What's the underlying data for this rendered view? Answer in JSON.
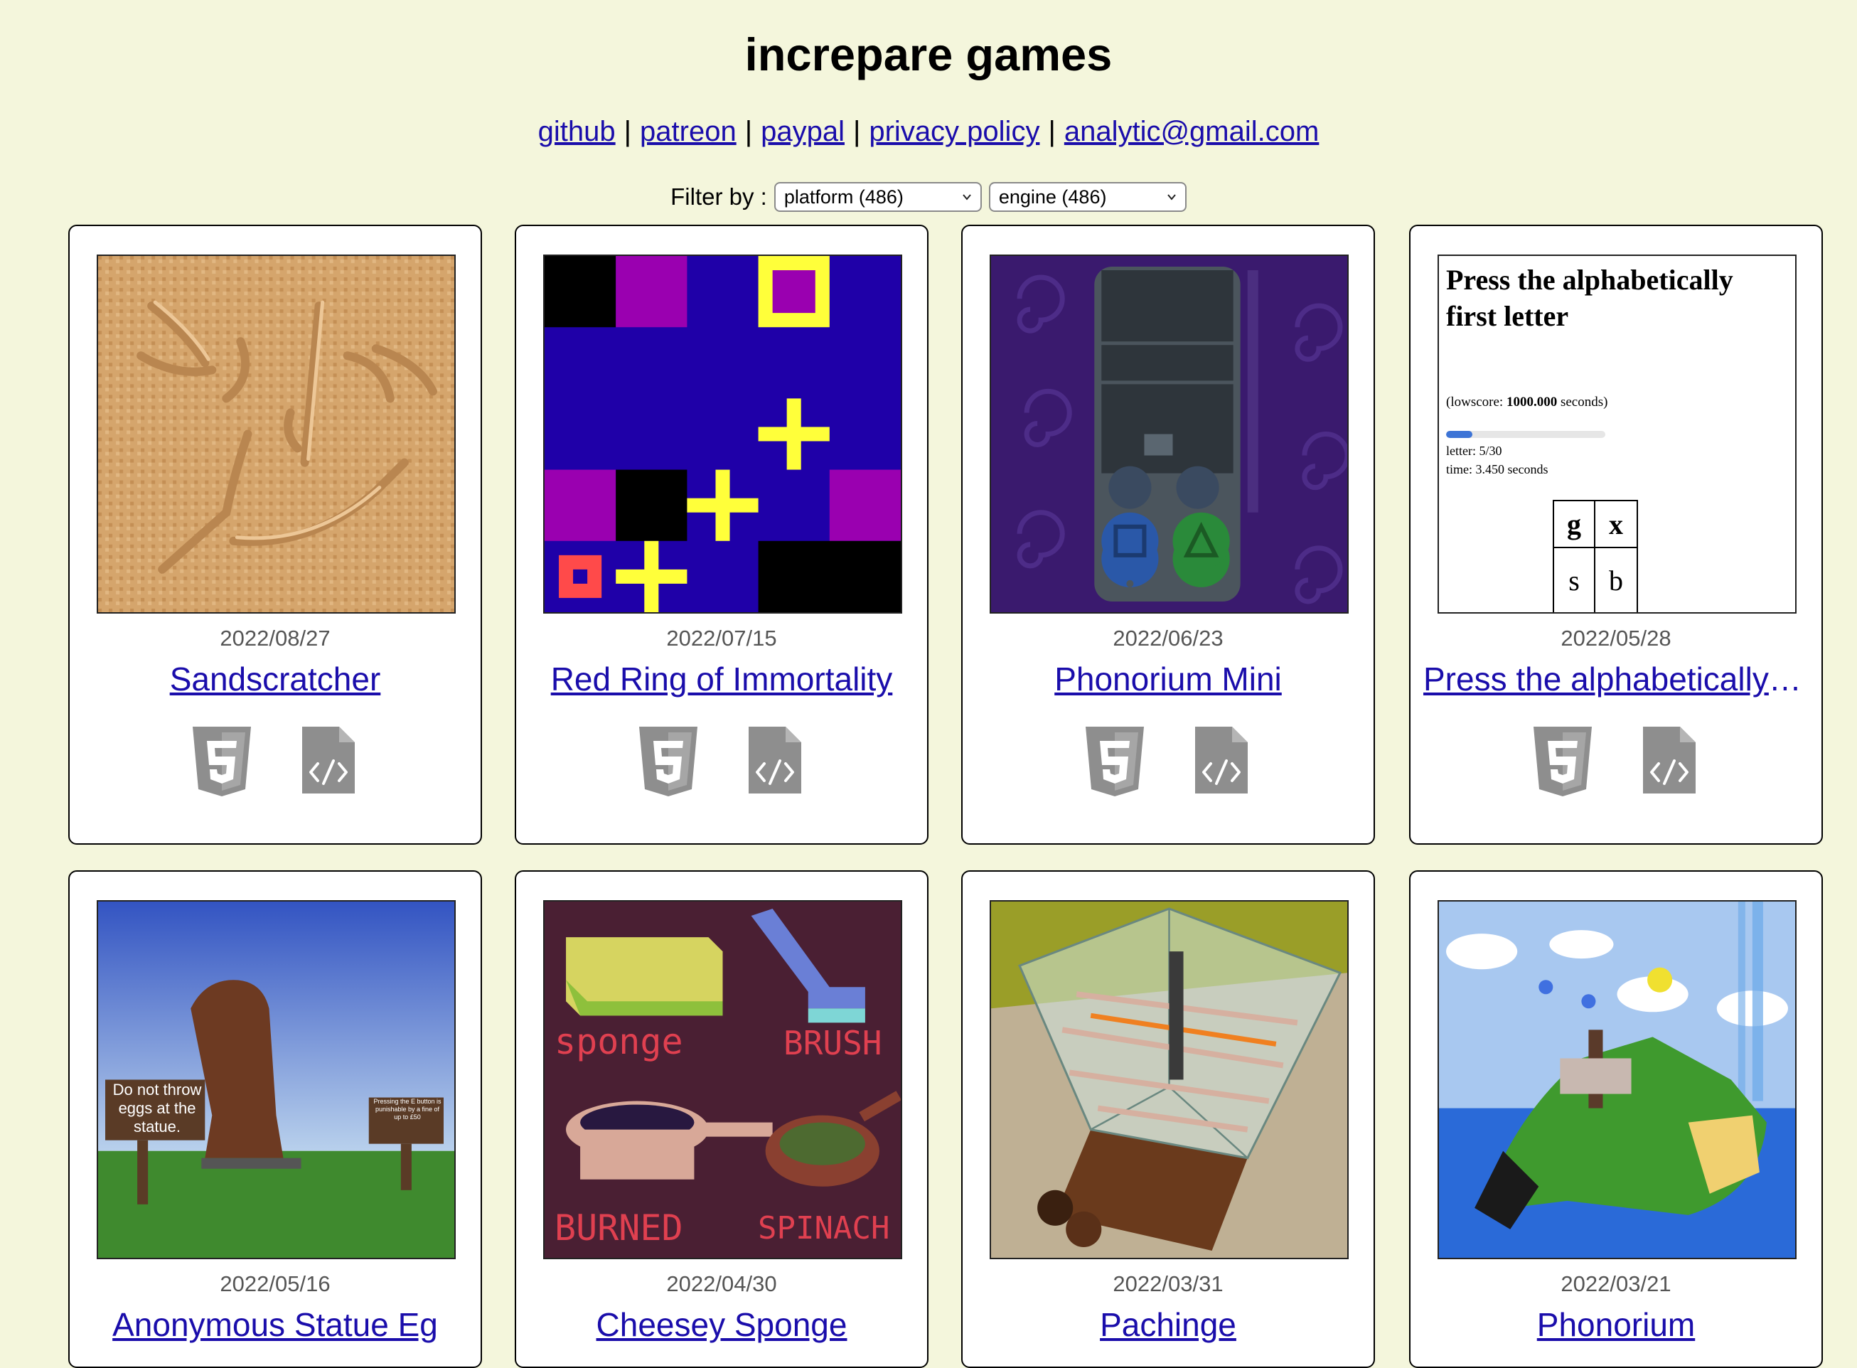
{
  "site": {
    "title": "increpare games",
    "links": [
      {
        "label": "github"
      },
      {
        "label": "patreon"
      },
      {
        "label": "paypal"
      },
      {
        "label": "privacy policy"
      },
      {
        "label": "analytic@gmail.com"
      }
    ],
    "separator": "|"
  },
  "filter": {
    "label": "Filter by :",
    "platform_value": "platform (486)",
    "engine_value": "engine (486)"
  },
  "games": [
    {
      "date": "2022/08/27",
      "title": "Sandscratcher",
      "platform_icon": "html5-icon",
      "source_icon": "source-code-icon"
    },
    {
      "date": "2022/07/15",
      "title": "Red Ring of Immortality",
      "platform_icon": "html5-icon",
      "source_icon": "source-code-icon"
    },
    {
      "date": "2022/06/23",
      "title": "Phonorium Mini",
      "platform_icon": "html5-icon",
      "source_icon": "source-code-icon"
    },
    {
      "date": "2022/05/28",
      "title": "Press the alphabetically first letter",
      "platform_icon": "html5-icon",
      "source_icon": "source-code-icon",
      "thumb_text": {
        "heading": "Press the alphabetically first letter",
        "lowscore_prefix": "(lowscore: ",
        "lowscore_value": "1000.000",
        "lowscore_suffix": " seconds)",
        "progress": 0.167,
        "letter": "letter: 5/30",
        "time": "time: 3.450 seconds",
        "cells": [
          "g",
          "x",
          "s",
          "b"
        ]
      }
    },
    {
      "date": "2022/05/16",
      "title": "Anonymous Statue Eg",
      "thumb_text": {
        "sign1": "Do not throw eggs at the statue.",
        "sign2": "Pressing the E button is punishable by a fine of up to £50"
      }
    },
    {
      "date": "2022/04/30",
      "title": "Cheesey Sponge",
      "thumb_text": {
        "w1": "sponge",
        "w2": "BRUSH",
        "w3": "BURNED",
        "w4": "SPINACH"
      }
    },
    {
      "date": "2022/03/31",
      "title": "Pachinge"
    },
    {
      "date": "2022/03/21",
      "title": "Phonorium"
    }
  ],
  "colors": {
    "background": "#f4f6dc",
    "link": "#1a0dab",
    "icon_gray": "#8e8e8e"
  }
}
